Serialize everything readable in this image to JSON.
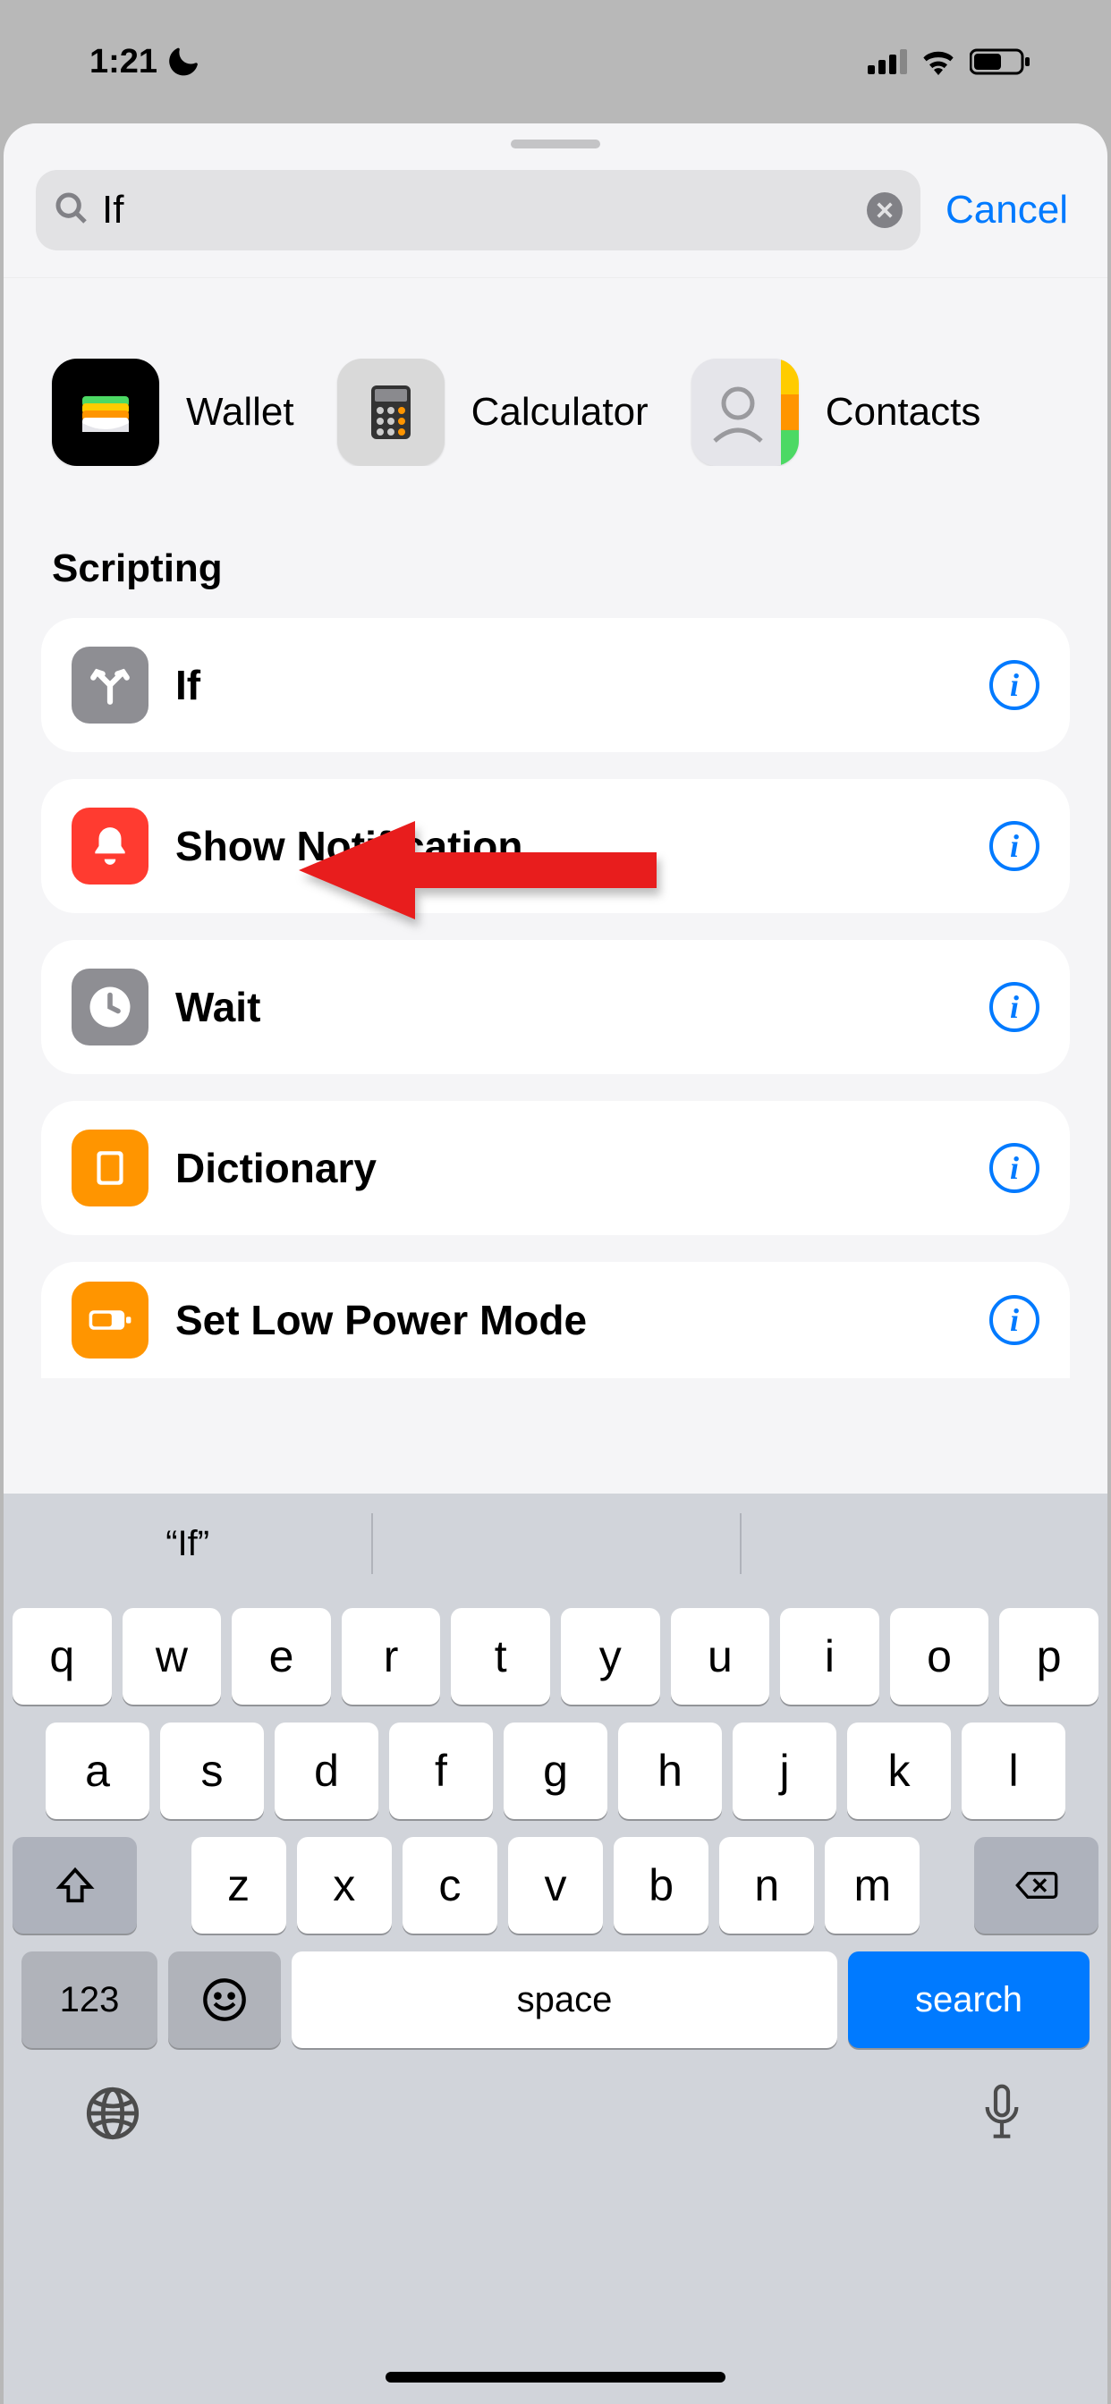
{
  "status": {
    "time": "1:21",
    "dnd": true,
    "signal": 3,
    "wifi": true,
    "battery_pct": 55
  },
  "search": {
    "value": "If",
    "placeholder": "Search",
    "cancel_label": "Cancel"
  },
  "apps": [
    {
      "name": "Wallet"
    },
    {
      "name": "Calculator"
    },
    {
      "name": "Contacts"
    }
  ],
  "section_title": "Scripting",
  "actions": [
    {
      "title": "If",
      "icon_color": "#8e8e93"
    },
    {
      "title": "Show Notification",
      "icon_color": "#ff3b30"
    },
    {
      "title": "Wait",
      "icon_color": "#8e8e93"
    },
    {
      "title": "Dictionary",
      "icon_color": "#ff9500"
    },
    {
      "title": "Set Low Power Mode",
      "icon_color": "#ff9500"
    }
  ],
  "keyboard": {
    "suggestion": "“If”",
    "rows": [
      [
        "q",
        "w",
        "e",
        "r",
        "t",
        "y",
        "u",
        "i",
        "o",
        "p"
      ],
      [
        "a",
        "s",
        "d",
        "f",
        "g",
        "h",
        "j",
        "k",
        "l"
      ],
      [
        "z",
        "x",
        "c",
        "v",
        "b",
        "n",
        "m"
      ]
    ],
    "numbers_label": "123",
    "space_label": "space",
    "search_label": "search"
  },
  "annotation": {
    "arrow_target": "If"
  }
}
